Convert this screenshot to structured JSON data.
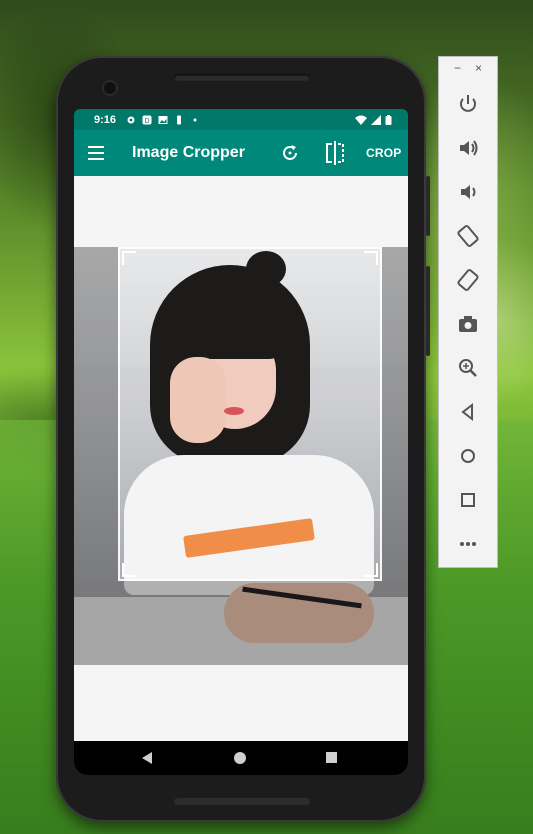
{
  "status_bar": {
    "time": "9:16"
  },
  "app_bar": {
    "title": "Image Cropper",
    "crop_label": "CROP"
  },
  "emulator": {
    "minimize": "−",
    "close": "×"
  },
  "colors": {
    "primary": "#00897b",
    "primary_dark": "#00796b"
  }
}
